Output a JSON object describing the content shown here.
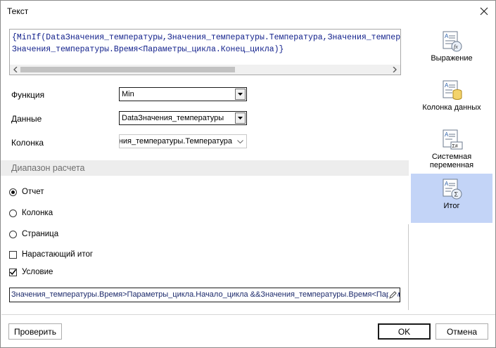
{
  "window": {
    "title": "Текст"
  },
  "expression": {
    "line1": "{MinIf(DataЗначения_температуры,Значения_температуры.Температура,Значения_температуры.Время>Параметры_цикла.Начало_цикла &&",
    "line2": "Значения_температуры.Время<Параметры_цикла.Конец_цикла)}"
  },
  "fields": {
    "function": {
      "label": "Функция",
      "value": "Min"
    },
    "data": {
      "label": "Данные",
      "value": "DataЗначения_температуры"
    },
    "column": {
      "label": "Колонка",
      "value": "Значения_температуры.Температура"
    }
  },
  "range": {
    "header": "Диапазон расчета",
    "options": [
      {
        "label": "Отчет",
        "selected": true
      },
      {
        "label": "Колонка",
        "selected": false
      },
      {
        "label": "Страница",
        "selected": false
      }
    ]
  },
  "checks": {
    "running_total": {
      "label": "Нарастающий итог",
      "checked": false
    },
    "condition": {
      "label": "Условие",
      "checked": true
    }
  },
  "condition_value": "Значения_температуры.Время>Параметры_цикла.Начало_цикла &&Значения_температуры.Время<Параметры_цикла.Конец_цикла",
  "sidebar": {
    "items": [
      {
        "label": "Выражение",
        "icon": "expression-icon",
        "selected": false
      },
      {
        "label": "Колонка данных",
        "icon": "data-column-icon",
        "selected": false
      },
      {
        "label": "Системная переменная",
        "icon": "system-variable-icon",
        "selected": false
      },
      {
        "label": "Итог",
        "icon": "total-icon",
        "selected": true
      }
    ]
  },
  "buttons": {
    "check": "Проверить",
    "ok": "OK",
    "cancel": "Отмена"
  },
  "colors": {
    "accent_selected": "#c3d4f7",
    "code_text": "#0e1d8a"
  }
}
